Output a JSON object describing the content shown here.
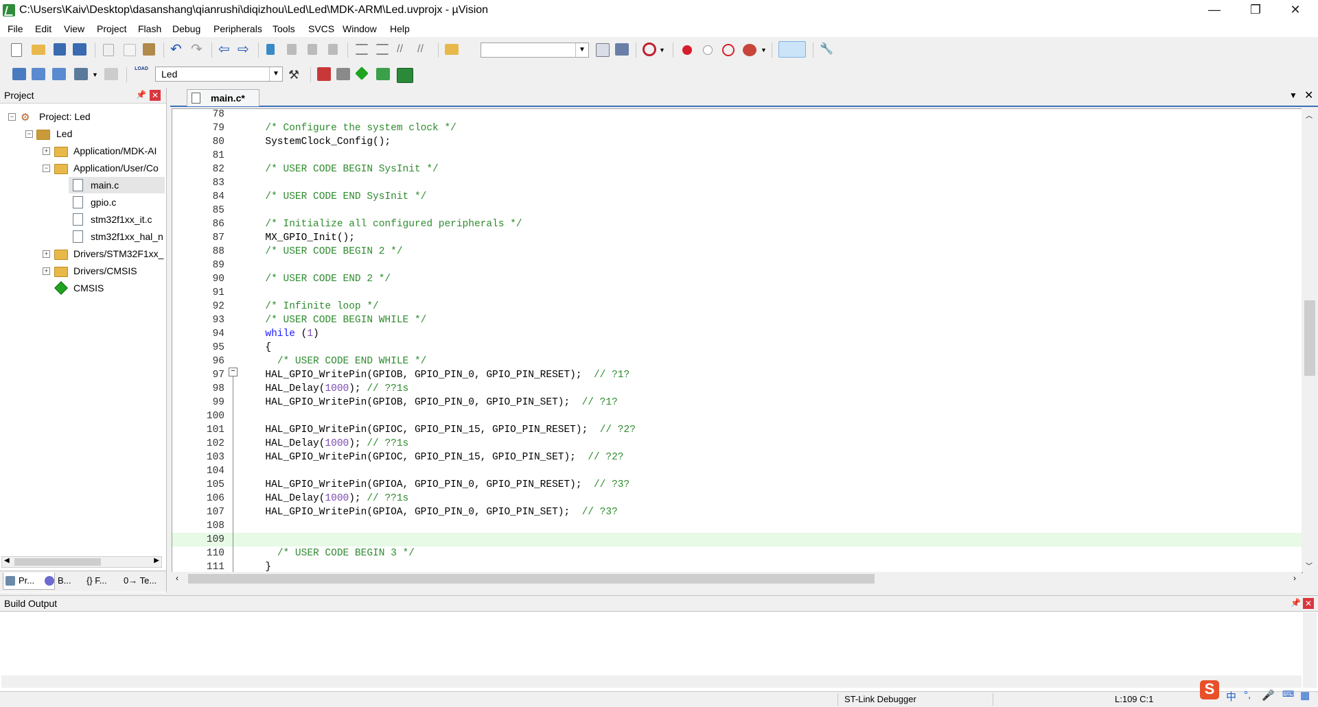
{
  "window": {
    "title": "C:\\Users\\Kaiv\\Desktop\\dasanshang\\qianrushi\\diqizhou\\Led\\Led\\MDK-ARM\\Led.uvprojx - µVision",
    "minimize": "—",
    "maximize": "❐",
    "close": "✕"
  },
  "menu": [
    "File",
    "Edit",
    "View",
    "Project",
    "Flash",
    "Debug",
    "Peripherals",
    "Tools",
    "SVCS",
    "Window",
    "Help"
  ],
  "toolbar2": {
    "target": "Led",
    "load_label": "LOAD"
  },
  "project": {
    "header": "Project",
    "tree": [
      {
        "label": "Project: Led"
      },
      {
        "label": "Led"
      },
      {
        "label": "Application/MDK-AI"
      },
      {
        "label": "Application/User/Co"
      },
      {
        "label": "main.c"
      },
      {
        "label": "gpio.c"
      },
      {
        "label": "stm32f1xx_it.c"
      },
      {
        "label": "stm32f1xx_hal_n"
      },
      {
        "label": "Drivers/STM32F1xx_"
      },
      {
        "label": "Drivers/CMSIS"
      },
      {
        "label": "CMSIS"
      }
    ],
    "tabs": [
      "Pr...",
      "B...",
      "{} F...",
      "0→ Te..."
    ]
  },
  "editor": {
    "tab": "main.c*",
    "lines": [
      {
        "n": "78",
        "t": ""
      },
      {
        "n": "79",
        "t": "  /* Configure the system clock */"
      },
      {
        "n": "80",
        "t": "  SystemClock_Config();"
      },
      {
        "n": "81",
        "t": ""
      },
      {
        "n": "82",
        "t": "  /* USER CODE BEGIN SysInit */"
      },
      {
        "n": "83",
        "t": ""
      },
      {
        "n": "84",
        "t": "  /* USER CODE END SysInit */"
      },
      {
        "n": "85",
        "t": ""
      },
      {
        "n": "86",
        "t": "  /* Initialize all configured peripherals */"
      },
      {
        "n": "87",
        "t": "  MX_GPIO_Init();"
      },
      {
        "n": "88",
        "t": "  /* USER CODE BEGIN 2 */"
      },
      {
        "n": "89",
        "t": ""
      },
      {
        "n": "90",
        "t": "  /* USER CODE END 2 */"
      },
      {
        "n": "91",
        "t": ""
      },
      {
        "n": "92",
        "t": "  /* Infinite loop */"
      },
      {
        "n": "93",
        "t": "  /* USER CODE BEGIN WHILE */"
      },
      {
        "n": "94",
        "t": "  while (1)"
      },
      {
        "n": "95",
        "t": "  {"
      },
      {
        "n": "96",
        "t": "    /* USER CODE END WHILE */"
      },
      {
        "n": "97",
        "t": "  HAL_GPIO_WritePin(GPIOB, GPIO_PIN_0, GPIO_PIN_RESET);  // ?1?"
      },
      {
        "n": "98",
        "t": "  HAL_Delay(1000); // ??1s"
      },
      {
        "n": "99",
        "t": "  HAL_GPIO_WritePin(GPIOB, GPIO_PIN_0, GPIO_PIN_SET);  // ?1?"
      },
      {
        "n": "100",
        "t": ""
      },
      {
        "n": "101",
        "t": "  HAL_GPIO_WritePin(GPIOC, GPIO_PIN_15, GPIO_PIN_RESET);  // ?2?"
      },
      {
        "n": "102",
        "t": "  HAL_Delay(1000); // ??1s"
      },
      {
        "n": "103",
        "t": "  HAL_GPIO_WritePin(GPIOC, GPIO_PIN_15, GPIO_PIN_SET);  // ?2?"
      },
      {
        "n": "104",
        "t": ""
      },
      {
        "n": "105",
        "t": "  HAL_GPIO_WritePin(GPIOA, GPIO_PIN_0, GPIO_PIN_RESET);  // ?3?"
      },
      {
        "n": "106",
        "t": "  HAL_Delay(1000); // ??1s"
      },
      {
        "n": "107",
        "t": "  HAL_GPIO_WritePin(GPIOA, GPIO_PIN_0, GPIO_PIN_SET);  // ?3?"
      },
      {
        "n": "108",
        "t": ""
      },
      {
        "n": "109",
        "t": ""
      },
      {
        "n": "110",
        "t": "    /* USER CODE BEGIN 3 */"
      },
      {
        "n": "111",
        "t": "  }"
      }
    ],
    "active_line": "109"
  },
  "build": {
    "header": "Build Output"
  },
  "status": {
    "debugger": "ST-Link Debugger",
    "cursor": "L:109 C:1"
  },
  "ime": {
    "logo": "S",
    "lang": "中"
  },
  "colors": {
    "comment": "#2e8b2e",
    "keyword": "#1a1aff",
    "number": "#7a49b3",
    "active_line": "#e6fae6",
    "close_red": "#d9363e"
  }
}
